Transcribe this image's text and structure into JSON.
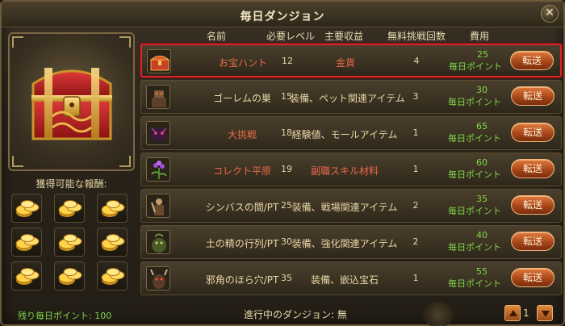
{
  "window": {
    "title": "毎日ダンジョン"
  },
  "columns": {
    "name": "名前",
    "level": "必要レベル",
    "reward": "主要収益",
    "free_tries": "無料挑戦回数",
    "cost": "費用"
  },
  "rows": [
    {
      "name": "お宝ハント",
      "level": "12",
      "reward": "金貨",
      "free": "4",
      "cost_amount": "25",
      "cost_unit": "毎日ポイント",
      "button": "転送",
      "selected": true,
      "name_color": "red",
      "reward_color": "red",
      "icon": "treasure-chest-icon"
    },
    {
      "name": "ゴーレムの巣",
      "level": "15",
      "reward": "装備、ペット関連アイテム",
      "free": "3",
      "cost_amount": "30",
      "cost_unit": "毎日ポイント",
      "button": "転送",
      "icon": "golem-icon"
    },
    {
      "name": "大挑戦",
      "level": "18",
      "reward": "経験値、モールアイテム",
      "free": "1",
      "cost_amount": "65",
      "cost_unit": "毎日ポイント",
      "button": "転送",
      "name_color": "red",
      "icon": "demon-icon"
    },
    {
      "name": "コレクト平原",
      "level": "19",
      "reward": "副職スキル材料",
      "free": "1",
      "cost_amount": "60",
      "cost_unit": "毎日ポイント",
      "button": "転送",
      "name_color": "red",
      "reward_color": "red",
      "icon": "herb-icon"
    },
    {
      "name": "シンバスの間/PT",
      "level": "25",
      "reward": "装備、戦場関連アイテム",
      "free": "2",
      "cost_amount": "35",
      "cost_unit": "毎日ポイント",
      "button": "転送",
      "icon": "warrior-icon"
    },
    {
      "name": "土の精の行列/PT",
      "level": "30",
      "reward": "装備、強化関連アイテム",
      "free": "2",
      "cost_amount": "40",
      "cost_unit": "毎日ポイント",
      "button": "転送",
      "icon": "earth-spirit-icon"
    },
    {
      "name": "邪角のほら穴/PT",
      "level": "35",
      "reward": "装備、嵌込宝石",
      "free": "1",
      "cost_amount": "55",
      "cost_unit": "毎日ポイント",
      "button": "転送",
      "icon": "horned-beast-icon"
    }
  ],
  "left": {
    "rewards_label": "獲得可能な報酬:",
    "remaining": "残り毎日ポイント: 100"
  },
  "footer": {
    "status": "進行中のダンジョン: 無",
    "page": "1"
  },
  "colors": {
    "selected_border": "#e0232a",
    "green_text": "#7fd84a",
    "red_text": "#e86a4a"
  }
}
